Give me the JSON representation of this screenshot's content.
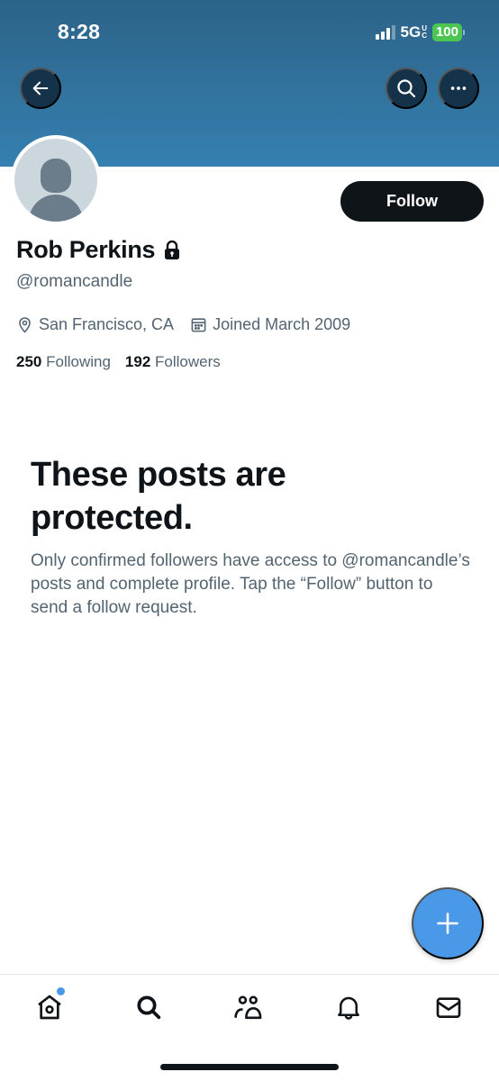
{
  "status_bar": {
    "time": "8:28",
    "network": "5G",
    "network_suffix_top": "U",
    "network_suffix_bottom": "C",
    "battery": "100",
    "signal_bars": 3,
    "signal_bars_max": 4
  },
  "header": {
    "back_icon": "arrow-left-icon",
    "search_icon": "search-icon",
    "more_icon": "more-horizontal-icon",
    "banner_color": "#3580b1"
  },
  "profile": {
    "display_name": "Rob Perkins",
    "protected_icon": "lock-icon",
    "handle": "@romancandle",
    "location": "San Francisco, CA",
    "joined": "Joined March 2009",
    "following_count": "250",
    "following_label": "Following",
    "followers_count": "192",
    "followers_label": "Followers",
    "follow_button_label": "Follow"
  },
  "protected_notice": {
    "title": "These posts are protected.",
    "body": "Only confirmed followers have access to @romancandle’s posts and complete profile. Tap the “Follow” button to send a follow request."
  },
  "fab": {
    "icon": "plus-icon",
    "color": "#4a99e9"
  },
  "tab_bar": {
    "items": [
      {
        "name": "home",
        "icon": "home-icon",
        "has_badge": true
      },
      {
        "name": "search",
        "icon": "search-icon"
      },
      {
        "name": "communities",
        "icon": "communities-icon"
      },
      {
        "name": "notifications",
        "icon": "bell-icon"
      },
      {
        "name": "messages",
        "icon": "mail-icon"
      }
    ]
  }
}
